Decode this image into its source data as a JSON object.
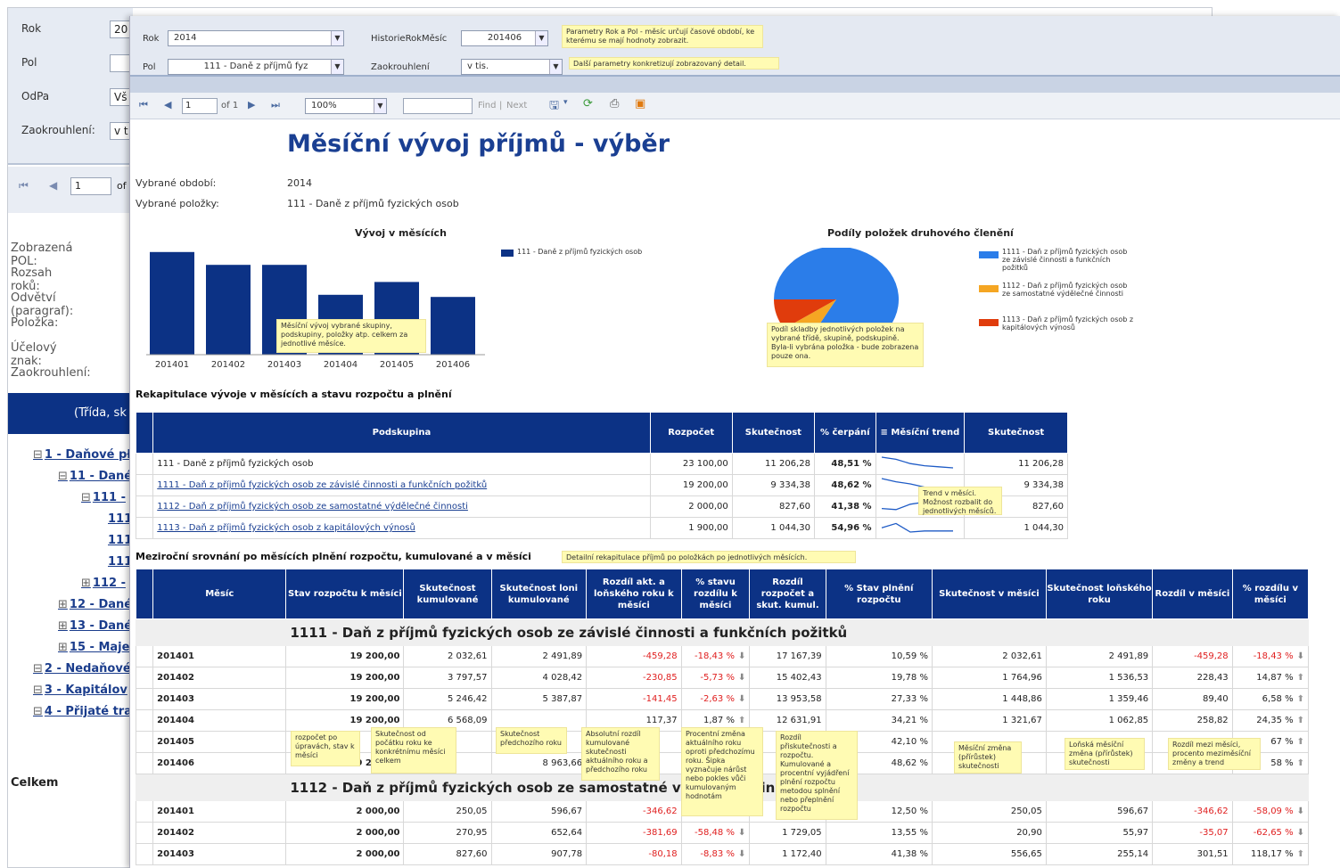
{
  "back": {
    "params": [
      {
        "label": "Rok",
        "value": "20"
      },
      {
        "label": "Pol",
        "value": ""
      },
      {
        "label": "OdPa",
        "value": "Vš"
      },
      {
        "label": "Zaokrouhlení:",
        "value": "v t"
      }
    ],
    "page_input": "1",
    "page_of": "of",
    "labels": [
      "Zobrazená POL:",
      "Rozsah roků:",
      "Odvětví (paragraf):",
      "Položka:",
      "Účelový znak:",
      "Zaokrouhlení:"
    ],
    "header_text": "(Třída, sk",
    "tree": [
      {
        "text": "1 - Daňové pł",
        "prefix": "⊟",
        "level": 1
      },
      {
        "text": "11 - Dané",
        "prefix": "⊟",
        "level": 2
      },
      {
        "text": "111 -",
        "prefix": "⊟",
        "level": 3
      },
      {
        "text": "111",
        "prefix": "",
        "level": 4
      },
      {
        "text": "111",
        "prefix": "",
        "level": 4
      },
      {
        "text": "111",
        "prefix": "",
        "level": 4
      },
      {
        "text": "112 -",
        "prefix": "⊞",
        "level": 3
      },
      {
        "text": "12 - Dané",
        "prefix": "⊞",
        "level": 2
      },
      {
        "text": "13 - Dané",
        "prefix": "⊞",
        "level": 2
      },
      {
        "text": "15 - Maje",
        "prefix": "⊞",
        "level": 2
      },
      {
        "text": "2 - Nedaňové",
        "prefix": "⊟",
        "level": 1
      },
      {
        "text": "3 - Kapitálov",
        "prefix": "⊟",
        "level": 1
      },
      {
        "text": "4 - Přijaté tra",
        "prefix": "⊟",
        "level": 1
      }
    ],
    "total_label": "Celkem"
  },
  "params": {
    "rok_label": "Rok",
    "rok_value": "2014",
    "hist_label": "HistorieRokMěsíc",
    "hist_value": "201406",
    "pol_label": "Pol",
    "pol_value": "111 - Daně z příjmů fyz",
    "zaok_label": "Zaokrouhlení",
    "zaok_value": "v tis.",
    "tip1": "Parametry Rok a Pol - měsíc určují časové období, ke kterému se mají hodnoty zobrazit.",
    "tip2": "Další parametry konkretizují zobrazovaný detail."
  },
  "toolbar": {
    "page": "1",
    "of": "of 1",
    "zoom": "100%",
    "find": "Find",
    "next": "Next"
  },
  "report": {
    "title": "Měsíční vývoj příjmů - výběr",
    "period_label": "Vybrané období:",
    "period_value": "2014",
    "items_label": "Vybrané položky:",
    "items_value": "111 - Daně z příjmů fyzických osob"
  },
  "chart_data": [
    {
      "type": "bar",
      "title": "Vývoj v měsících",
      "categories": [
        "201401",
        "201402",
        "201403",
        "201404",
        "201405",
        "201406"
      ],
      "series": [
        {
          "name": "111 - Daně z příjmů fyzických osob",
          "values": [
            4800,
            4200,
            4200,
            2800,
            3400,
            2700
          ]
        }
      ],
      "ylim": [
        0,
        5000
      ],
      "tooltip": "Měsíční vývoj vybrané skupiny, podskupiny, položky atp. celkem za jednotlivé měsíce.",
      "color": "#0c3285"
    },
    {
      "type": "pie",
      "title": "Podíly položek druhového členění",
      "categories": [
        "1111 - Daň z příjmů fyzických osob ze závislé činnosti a funkčních požitků",
        "1112 - Daň z příjmů fyzických osob ze samostatné výdělečné činnosti",
        "1113 - Daň z příjmů fyzických osob z kapitálových výnosů"
      ],
      "values": [
        83.3,
        7.4,
        9.3
      ],
      "colors": [
        "#2b7de9",
        "#f5a623",
        "#e03c0c"
      ],
      "tooltip": "Podíl skladby jednotlivých položek na vybrané třídě, skupině, podskupině. Byla-li vybrána položka - bude zobrazena pouze ona."
    }
  ],
  "recap": {
    "title": "Rekapitulace vývoje v měsících a stavu rozpočtu a plnění",
    "headers": [
      "Podskupina",
      "Rozpočet",
      "Skutečnost",
      "% čerpání",
      "≡ Měsíční trend",
      "Skutečnost"
    ],
    "rows": [
      {
        "name": "111 - Daně z příjmů fyzických osob",
        "rozpocet": "23 100,00",
        "skut": "11 206,28",
        "pct": "48,51 %",
        "skut2": "11 206,28",
        "link": false
      },
      {
        "name": "1111 - Daň z příjmů fyzických osob ze závislé činnosti a funkčních požitků",
        "rozpocet": "19 200,00",
        "skut": "9 334,38",
        "pct": "48,62 %",
        "skut2": "9 334,38",
        "link": true
      },
      {
        "name": "1112 - Daň z příjmů fyzických osob ze samostatné výdělečné činnosti",
        "rozpocet": "2 000,00",
        "skut": "827,60",
        "pct": "41,38 %",
        "skut2": "827,60",
        "link": true
      },
      {
        "name": "1113 - Daň z příjmů fyzických osob z kapitálových výnosů",
        "rozpocet": "1 900,00",
        "skut": "1 044,30",
        "pct": "54,96 %",
        "skut2": "1 044,30",
        "link": true
      }
    ],
    "trend_tip": "Trend v měsíci. Možnost rozbalit do jednotlivých měsíců."
  },
  "yoy": {
    "title": "Meziroční srovnání po měsících plnění rozpočtu, kumulované a v měsíci",
    "title_tip": "Detailní rekapitulace příjmů po položkách po jednotlivých měsících.",
    "headers": [
      "Měsíc",
      "Stav rozpočtu k měsíci",
      "Skutečnost kumulované",
      "Skutečnost loni kumulované",
      "Rozdíl akt. a loňského roku k měsíci",
      "% stavu rozdílu k měsíci",
      "Rozdíl rozpočet a skut. kumul.",
      "% Stav plnění rozpočtu",
      "Skutečnost v měsíci",
      "Skutečnost loňského roku",
      "Rozdíl v měsíci",
      "% rozdílu v měsíci"
    ],
    "group1": "1111 - Daň z příjmů fyzických osob ze závislé činnosti a funkčních požitků",
    "rows1": [
      [
        "201401",
        "19 200,00",
        "2 032,61",
        "2 491,89",
        "-459,28",
        "-18,43 %",
        "17 167,39",
        "10,59 %",
        "2 032,61",
        "2 491,89",
        "-459,28",
        "-18,43 %"
      ],
      [
        "201402",
        "19 200,00",
        "3 797,57",
        "4 028,42",
        "-230,85",
        "-5,73 %",
        "15 402,43",
        "19,78 %",
        "1 764,96",
        "1 536,53",
        "228,43",
        "14,87 %"
      ],
      [
        "201403",
        "19 200,00",
        "5 246,42",
        "5 387,87",
        "-141,45",
        "-2,63 %",
        "13 953,58",
        "27,33 %",
        "1 448,86",
        "1 359,46",
        "89,40",
        "6,58 %"
      ],
      [
        "201404",
        "19 200,00",
        "6 568,09",
        "",
        "117,37",
        "1,87 %",
        "12 631,91",
        "34,21 %",
        "1 321,67",
        "1 062,85",
        "258,82",
        "24,35 %"
      ],
      [
        "201405",
        "",
        "",
        "",
        "",
        "",
        "",
        "42,10 %",
        "",
        "",
        "",
        "67 %"
      ],
      [
        "201406",
        "19 200,00",
        "",
        "8 963,66",
        "",
        "",
        "",
        "48,62 %",
        "",
        "",
        "",
        "58 %"
      ]
    ],
    "group2": "1112 - Daň z příjmů fyzických osob ze samostatné výdělečné činnosti",
    "rows2": [
      [
        "201401",
        "2 000,00",
        "250,05",
        "596,67",
        "-346,62",
        "-58,09 %",
        "1 749,95",
        "12,50 %",
        "250,05",
        "596,67",
        "-346,62",
        "-58,09 %"
      ],
      [
        "201402",
        "2 000,00",
        "270,95",
        "652,64",
        "-381,69",
        "-58,48 %",
        "1 729,05",
        "13,55 %",
        "20,90",
        "55,97",
        "-35,07",
        "-62,65 %"
      ],
      [
        "201403",
        "2 000,00",
        "827,60",
        "907,78",
        "-80,18",
        "-8,83 %",
        "1 172,40",
        "41,38 %",
        "556,65",
        "255,14",
        "301,51",
        "118,17 %"
      ]
    ],
    "tips": [
      "rozpočet po úpravách, stav k měsíci",
      "Skutečnost od počátku roku ke konkrétnímu měsíci celkem",
      "Skutečnost předchozího roku",
      "Absolutní rozdíl kumulované skutečnosti aktuálního roku a předchozího roku",
      "Procentní změna aktuálního roku oproti předchozímu roku. Šipka vyznačuje nárůst nebo pokles vůči kumulovaným hodnotám",
      "Rozdíl přiskutečnosti a rozpočtu. Kumulované a procentní vyjádření plnění rozpočtu metodou splnění nebo přeplnění rozpočtu",
      "Měsíční změna (přírůstek) skutečnosti",
      "Loňská měsíční změna (přírůstek) skutečnosti",
      "Rozdíl mezi měsíci, procento meziměsíční změny a trend"
    ]
  }
}
